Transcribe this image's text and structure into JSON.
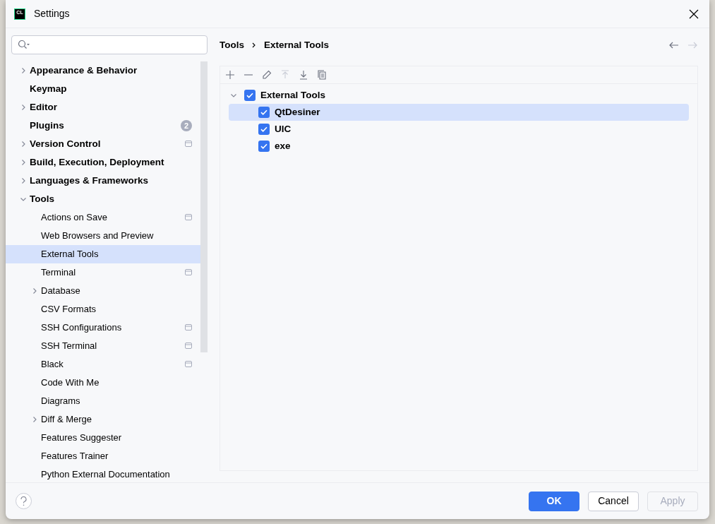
{
  "window": {
    "title": "Settings",
    "logo_text": "CL"
  },
  "sidebar": {
    "items": [
      {
        "label": "Appearance & Behavior",
        "expanded": false,
        "selected": false
      },
      {
        "label": "Keymap",
        "selected": false
      },
      {
        "label": "Editor",
        "expanded": false,
        "selected": false
      },
      {
        "label": "Plugins",
        "badge": "2",
        "selected": false
      },
      {
        "label": "Version Control",
        "expanded": false,
        "project_scope": true,
        "selected": false
      },
      {
        "label": "Build, Execution, Deployment",
        "expanded": false,
        "selected": false
      },
      {
        "label": "Languages & Frameworks",
        "expanded": false,
        "selected": false
      },
      {
        "label": "Tools",
        "expanded": true,
        "selected": false,
        "children": [
          {
            "label": "Actions on Save",
            "project_scope": true,
            "selected": false
          },
          {
            "label": "Web Browsers and Preview",
            "selected": false
          },
          {
            "label": "External Tools",
            "selected": true
          },
          {
            "label": "Terminal",
            "project_scope": true,
            "selected": false
          },
          {
            "label": "Database",
            "expanded": false,
            "selected": false
          },
          {
            "label": "CSV Formats",
            "selected": false
          },
          {
            "label": "SSH Configurations",
            "project_scope": true,
            "selected": false
          },
          {
            "label": "SSH Terminal",
            "project_scope": true,
            "selected": false
          },
          {
            "label": "Black",
            "project_scope": true,
            "selected": false
          },
          {
            "label": "Code With Me",
            "selected": false
          },
          {
            "label": "Diagrams",
            "selected": false
          },
          {
            "label": "Diff & Merge",
            "expanded": false,
            "selected": false
          },
          {
            "label": "Features Suggester",
            "selected": false
          },
          {
            "label": "Features Trainer",
            "selected": false
          },
          {
            "label": "Python External Documentation",
            "selected": false
          }
        ]
      }
    ]
  },
  "breadcrumb": [
    "Tools",
    "External Tools"
  ],
  "navigation": {
    "back_disabled": false,
    "forward_disabled": true
  },
  "toolbar": [
    {
      "kind": "add",
      "disabled": false
    },
    {
      "kind": "remove",
      "disabled": false
    },
    {
      "kind": "edit",
      "disabled": false
    },
    {
      "kind": "up",
      "disabled": true
    },
    {
      "kind": "down",
      "disabled": false
    },
    {
      "kind": "copy",
      "disabled": false
    }
  ],
  "tree": [
    {
      "label": "External Tools",
      "checked": true,
      "expanded": true,
      "selected": false,
      "children": [
        {
          "label": "QtDesiner",
          "checked": true,
          "selected": true
        },
        {
          "label": "UIC",
          "checked": true,
          "selected": false
        },
        {
          "label": "exe",
          "checked": true,
          "selected": false
        }
      ]
    }
  ],
  "buttons": [
    {
      "label": "OK",
      "kind": "primary",
      "disabled": false
    },
    {
      "label": "Cancel",
      "kind": "secondary",
      "disabled": false
    },
    {
      "label": "Apply",
      "kind": "secondary",
      "disabled": true
    }
  ]
}
